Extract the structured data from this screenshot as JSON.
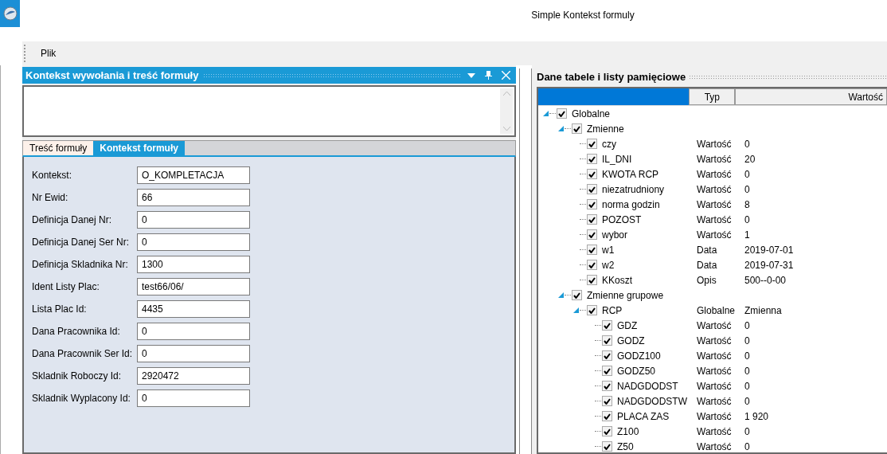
{
  "window": {
    "title": "Simple Kontekst formuly"
  },
  "menu": [
    "Plik"
  ],
  "left_panel": {
    "title": "Kontekst wywołania i treść formuły",
    "tabs": [
      {
        "label": "Treść formuły",
        "selected": false
      },
      {
        "label": "Kontekst formuły",
        "selected": true
      }
    ],
    "fields": [
      {
        "label": "Kontekst:",
        "value": "O_KOMPLETACJA"
      },
      {
        "label": "Nr Ewid:",
        "value": "66"
      },
      {
        "label": "Definicja Danej Nr:",
        "value": "0"
      },
      {
        "label": "Definicja Danej Ser Nr:",
        "value": "0"
      },
      {
        "label": "Definicja Skladnika Nr:",
        "value": "1300"
      },
      {
        "label": "Ident Listy Plac:",
        "value": "test66/06/"
      },
      {
        "label": "Lista Plac Id:",
        "value": "4435"
      },
      {
        "label": "Dana Pracownika Id:",
        "value": "0"
      },
      {
        "label": "Dana Pracownik Ser Id:",
        "value": "0"
      },
      {
        "label": "Skladnik Roboczy Id:",
        "value": "2920472"
      },
      {
        "label": "Skladnik Wyplacony Id:",
        "value": "0"
      }
    ]
  },
  "right_panel": {
    "title": "Dane tabele i listy pamięciowe",
    "columns": [
      "Typ",
      "Wartość"
    ],
    "tree": [
      {
        "label": "Globalne",
        "checked": true,
        "expanded": true,
        "children": [
          {
            "label": "Zmienne",
            "checked": true,
            "expanded": true,
            "children": [
              {
                "label": "czy",
                "checked": true,
                "type": "Wartość",
                "value": "0"
              },
              {
                "label": "IL_DNI",
                "checked": true,
                "type": "Wartość",
                "value": "20"
              },
              {
                "label": "KWOTA RCP",
                "checked": true,
                "type": "Wartość",
                "value": "0"
              },
              {
                "label": "niezatrudniony",
                "checked": true,
                "type": "Wartość",
                "value": "0"
              },
              {
                "label": "norma godzin",
                "checked": true,
                "type": "Wartość",
                "value": "8"
              },
              {
                "label": "POZOST",
                "checked": true,
                "type": "Wartość",
                "value": "0"
              },
              {
                "label": "wybor",
                "checked": true,
                "type": "Wartość",
                "value": "1"
              },
              {
                "label": "w1",
                "checked": true,
                "type": "Data",
                "value": "2019-07-01"
              },
              {
                "label": "w2",
                "checked": true,
                "type": "Data",
                "value": "2019-07-31"
              },
              {
                "label": "KKoszt",
                "checked": true,
                "type": "Opis",
                "value": "500--0-00"
              }
            ]
          },
          {
            "label": "Zmienne grupowe",
            "checked": true,
            "expanded": true,
            "children": [
              {
                "label": "RCP",
                "checked": true,
                "expanded": true,
                "type": "Globalne",
                "value": "Zmienna",
                "children": [
                  {
                    "label": "GDZ",
                    "checked": true,
                    "type": "Wartość",
                    "value": "0"
                  },
                  {
                    "label": "GODZ",
                    "checked": true,
                    "type": "Wartość",
                    "value": "0"
                  },
                  {
                    "label": "GODZ100",
                    "checked": true,
                    "type": "Wartość",
                    "value": "0"
                  },
                  {
                    "label": "GODZ50",
                    "checked": true,
                    "type": "Wartość",
                    "value": "0"
                  },
                  {
                    "label": "NADGDODST",
                    "checked": true,
                    "type": "Wartość",
                    "value": "0"
                  },
                  {
                    "label": "NADGDODSTW",
                    "checked": true,
                    "type": "Wartość",
                    "value": "0"
                  },
                  {
                    "label": "PLACA ZAS",
                    "checked": true,
                    "type": "Wartość",
                    "value": "1 920"
                  },
                  {
                    "label": "Z100",
                    "checked": true,
                    "type": "Wartość",
                    "value": "0"
                  },
                  {
                    "label": "Z50",
                    "checked": true,
                    "type": "Wartość",
                    "value": "0"
                  }
                ]
              }
            ]
          }
        ]
      }
    ]
  }
}
